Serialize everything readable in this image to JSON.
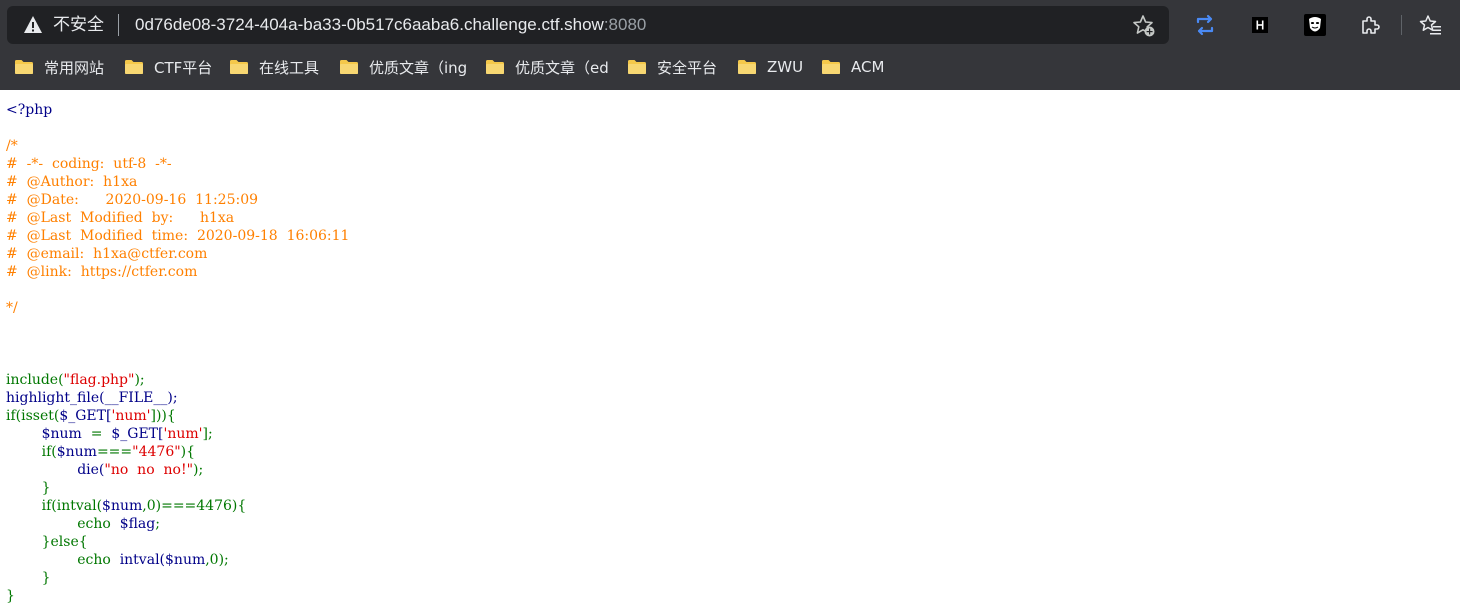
{
  "browser": {
    "security_label": "不安全",
    "url_host": "0d76de08-3724-404a-ba33-0b517c6aaba6.challenge.ctf.show",
    "url_port": ":8080",
    "toolbar_icons": [
      "star-add-icon",
      "refresh-sync-icon",
      "hackbar-extension-icon",
      "anonymous-mask-icon",
      "extensions-puzzle-icon",
      "favorites-icon"
    ],
    "colors": {
      "chrome_bg": "#35363a",
      "omnibox_bg": "#202124",
      "folder": "#f4c84a",
      "sync_blue": "#4a8af4"
    }
  },
  "bookmarks": [
    {
      "label": "常用网站"
    },
    {
      "label": "CTF平台"
    },
    {
      "label": "在线工具"
    },
    {
      "label": "优质文章（ing"
    },
    {
      "label": "优质文章（ed"
    },
    {
      "label": "安全平台"
    },
    {
      "label": "ZWU"
    },
    {
      "label": "ACM"
    }
  ],
  "code": {
    "open_tag": "<?php",
    "comment": "/*\n#  -*-  coding:  utf-8  -*-\n#  @Author:  h1xa\n#  @Date:      2020-09-16  11:25:09\n#  @Last  Modified  by:      h1xa\n#  @Last  Modified  time:  2020-09-18  16:06:11\n#  @email:  h1xa@ctfer.com\n#  @link:  https://ctfer.com\n\n*/",
    "include_fn": "include(",
    "include_arg": "\"flag.php\"",
    "include_end": ");",
    "highlight_line": "highlight_file(__FILE__);",
    "if_isset_a": "if(isset(",
    "get_var": "$_GET[",
    "num_key": "'num'",
    "if_isset_b": "])){",
    "indent1": "        ",
    "num_var": "$num",
    "assign": "  =  ",
    "close_bracket_semi": "];",
    "if_num_a": "if(",
    "strict_eq": "===",
    "str_4476": "\"4476\"",
    "brace_open_close": "){",
    "indent2": "                ",
    "die_a": "die(",
    "str_no": "\"no  no  no!\"",
    "close_brace": "}",
    "intval_if_a": "if(intval(",
    "comma_zero": ",0)===4476){",
    "echo_kw": "echo  ",
    "flag_var": "$flag",
    "semicolon": ";",
    "else_line": "}else{",
    "intval_call": "intval(",
    "zero_close": ",0);"
  }
}
